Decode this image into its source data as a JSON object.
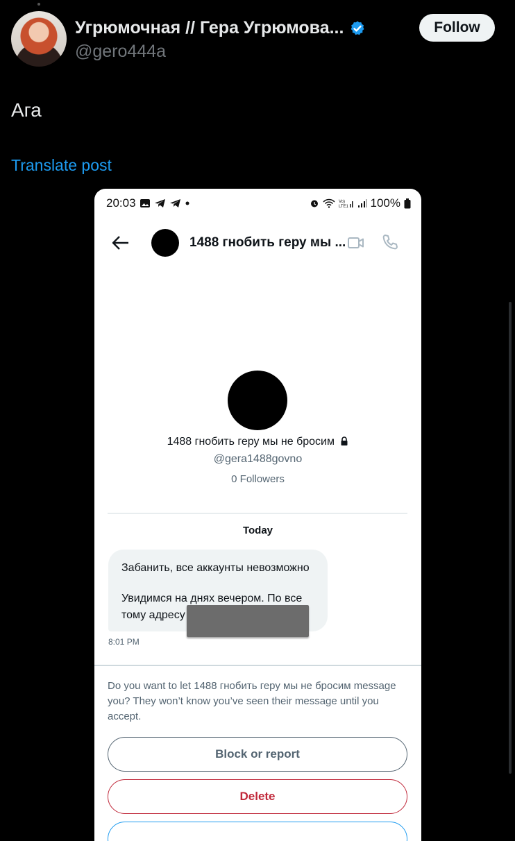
{
  "post": {
    "display_name": "Угрюмочная // Гера Угрюмова...",
    "handle": "@gero444a",
    "follow_label": "Follow",
    "text": "Ага",
    "translate_label": "Translate post"
  },
  "screenshot": {
    "status": {
      "time": "20:03",
      "battery": "100%"
    },
    "header": {
      "title": "1488 гнобить геру мы ..."
    },
    "profile": {
      "name": "1488 гнобить геру мы не бросим",
      "handle": "@gera1488govno",
      "followers": "0 Followers"
    },
    "day_label": "Today",
    "message": {
      "line1": "Забанить, все аккаунты невозможно",
      "line2": "Увидимся на днях вечером. По все",
      "line3": "тому адресу",
      "time": "8:01 PM"
    },
    "request_prompt": "Do you want to let 1488 гнобить геру мы не бросим message you? They won’t know you’ve seen their message until you accept.",
    "buttons": {
      "block": "Block or report",
      "delete": "Delete"
    }
  },
  "colors": {
    "background": "#000000",
    "link": "#1d9bf0",
    "verified": "#1d9bf0",
    "delete": "#c0283a"
  },
  "icons": {
    "verified": "verified-badge-icon",
    "back": "arrow-left-icon",
    "video": "video-camera-icon",
    "phone": "phone-icon",
    "lock": "lock-icon"
  }
}
